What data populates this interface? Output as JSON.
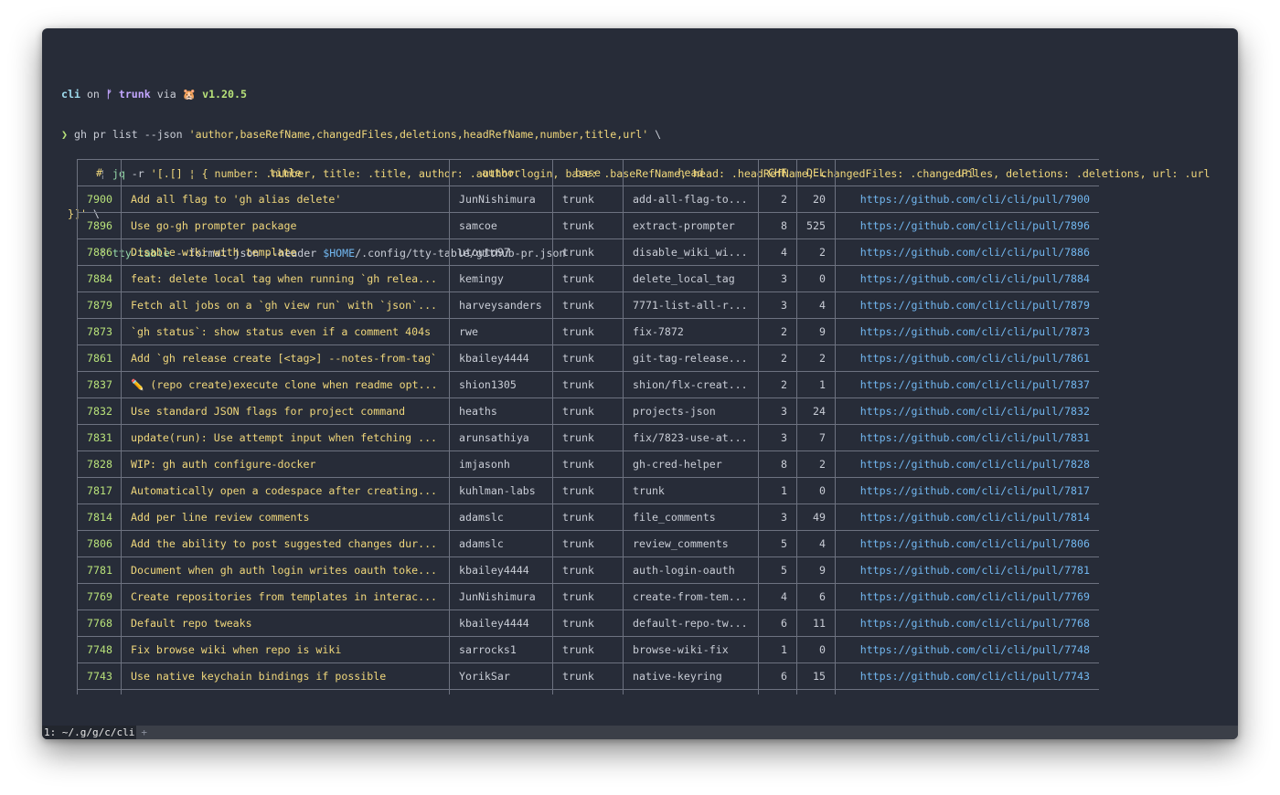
{
  "prompt": {
    "dir": "cli",
    "on": "on",
    "branch_icon": "ᚠ",
    "branch": "trunk",
    "via": "via",
    "go_icon": "🐹",
    "version": "v1.20.5",
    "arrow": "❯",
    "cmd1": "gh pr list --json ",
    "cmd1_str": "'author,baseRefName,changedFiles,deletions,headRefName,number,title,url'",
    "cmd1_tail": " \\",
    "indent": "      ",
    "pipe": "¦",
    "jq_tool": "jq",
    "jq_flag": " -r ",
    "jq_str": "'[.[] ¦ { number: .number, title: .title, author: .author.login, base: .baseRefName, head: .headRefName, changedFiles: .changedFiles, deletions: .deletions, url: .url",
    "jq_str2": " }]'",
    "jq_tail": " \\",
    "tt_tool": "tty-table",
    "tt_args": " --format json --header ",
    "tt_var": "$HOME",
    "tt_path": "/.config/tty-table/github-pr.json"
  },
  "table": {
    "headers": [
      "#",
      "title",
      "author",
      "base",
      "head",
      "CHF",
      "DEL",
      "url"
    ],
    "rows": [
      [
        "7900",
        "Add all flag to 'gh alias delete'",
        "JunNishimura",
        "trunk",
        "add-all-flag-to...",
        "2",
        "20",
        "https://github.com/cli/cli/pull/7900"
      ],
      [
        "7896",
        "Use go-gh prompter package",
        "samcoe",
        "trunk",
        "extract-prompter",
        "8",
        "525",
        "https://github.com/cli/cli/pull/7896"
      ],
      [
        "7886",
        "Disable wiki with template",
        "utouto97",
        "trunk",
        "disable_wiki_wi...",
        "4",
        "2",
        "https://github.com/cli/cli/pull/7886"
      ],
      [
        "7884",
        "feat: delete local tag when running `gh relea...",
        "kemingy",
        "trunk",
        "delete_local_tag",
        "3",
        "0",
        "https://github.com/cli/cli/pull/7884"
      ],
      [
        "7879",
        "Fetch all jobs on a `gh view run` with `json`...",
        "harveysanders",
        "trunk",
        "7771-list-all-r...",
        "3",
        "4",
        "https://github.com/cli/cli/pull/7879"
      ],
      [
        "7873",
        "`gh status`: show status even if a comment 404s",
        "rwe",
        "trunk",
        "fix-7872",
        "2",
        "9",
        "https://github.com/cli/cli/pull/7873"
      ],
      [
        "7861",
        "Add `gh release create [<tag>] --notes-from-tag`",
        "kbailey4444",
        "trunk",
        "git-tag-release...",
        "2",
        "2",
        "https://github.com/cli/cli/pull/7861"
      ],
      [
        "7837",
        "✏️ (repo create)execute clone when readme opt...",
        "shion1305",
        "trunk",
        "shion/flx-creat...",
        "2",
        "1",
        "https://github.com/cli/cli/pull/7837"
      ],
      [
        "7832",
        "Use standard JSON flags for project command",
        "heaths",
        "trunk",
        "projects-json",
        "3",
        "24",
        "https://github.com/cli/cli/pull/7832"
      ],
      [
        "7831",
        "update(run): Use attempt input when fetching ...",
        "arunsathiya",
        "trunk",
        "fix/7823-use-at...",
        "3",
        "7",
        "https://github.com/cli/cli/pull/7831"
      ],
      [
        "7828",
        "WIP: gh auth configure-docker",
        "imjasonh",
        "trunk",
        "gh-cred-helper",
        "8",
        "2",
        "https://github.com/cli/cli/pull/7828"
      ],
      [
        "7817",
        "Automatically open a codespace after creating...",
        "kuhlman-labs",
        "trunk",
        "trunk",
        "1",
        "0",
        "https://github.com/cli/cli/pull/7817"
      ],
      [
        "7814",
        "Add per line review comments",
        "adamslc",
        "trunk",
        "file_comments",
        "3",
        "49",
        "https://github.com/cli/cli/pull/7814"
      ],
      [
        "7806",
        "Add the ability to post suggested changes dur...",
        "adamslc",
        "trunk",
        "review_comments",
        "5",
        "4",
        "https://github.com/cli/cli/pull/7806"
      ],
      [
        "7781",
        "Document when gh auth login writes oauth toke...",
        "kbailey4444",
        "trunk",
        "auth-login-oauth",
        "5",
        "9",
        "https://github.com/cli/cli/pull/7781"
      ],
      [
        "7769",
        "Create repositories from templates in interac...",
        "JunNishimura",
        "trunk",
        "create-from-tem...",
        "4",
        "6",
        "https://github.com/cli/cli/pull/7769"
      ],
      [
        "7768",
        "Default repo tweaks",
        "kbailey4444",
        "trunk",
        "default-repo-tw...",
        "6",
        "11",
        "https://github.com/cli/cli/pull/7768"
      ],
      [
        "7748",
        "Fix browse wiki when repo is wiki",
        "sarrocks1",
        "trunk",
        "browse-wiki-fix",
        "1",
        "0",
        "https://github.com/cli/cli/pull/7748"
      ],
      [
        "7743",
        "Use native keychain bindings if possible",
        "YorikSar",
        "trunk",
        "native-keyring",
        "6",
        "15",
        "https://github.com/cli/cli/pull/7743"
      ],
      [
        "",
        "",
        "",
        "",
        "",
        "",
        "",
        ""
      ]
    ]
  },
  "statusbar": {
    "tab": "1: ~/.g/g/c/cli",
    "plus": "+"
  },
  "colors": {
    "background": "#272c38",
    "number": "#b8e27a",
    "title": "#f0d77b",
    "url": "#72b7f0",
    "border": "#6d7280"
  }
}
